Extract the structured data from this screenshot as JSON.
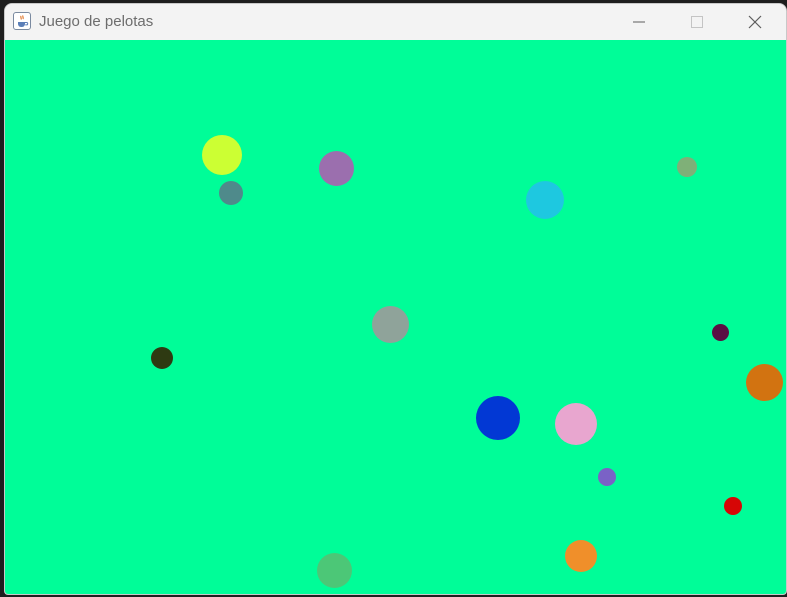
{
  "window": {
    "title": "Juego de pelotas",
    "app_icon": "java-cup-icon",
    "controls": [
      "minimize-icon",
      "maximize-icon",
      "close-icon"
    ]
  },
  "canvas": {
    "background_color": "#00fd98"
  },
  "balls": [
    {
      "color": "#ccff33"
    },
    {
      "color": "#4f8a8b"
    },
    {
      "color": "#9b6fae"
    },
    {
      "color": "#1ec8e0"
    },
    {
      "color": "#7fb078"
    },
    {
      "color": "#8fa39a"
    },
    {
      "color": "#2e3a12"
    },
    {
      "color": "#5a0f44"
    },
    {
      "color": "#d27311"
    },
    {
      "color": "#0238d4"
    },
    {
      "color": "#e8a6cf"
    },
    {
      "color": "#7a62c6"
    },
    {
      "color": "#d60606"
    },
    {
      "color": "#f08f2a"
    },
    {
      "color": "#4cc777"
    }
  ]
}
